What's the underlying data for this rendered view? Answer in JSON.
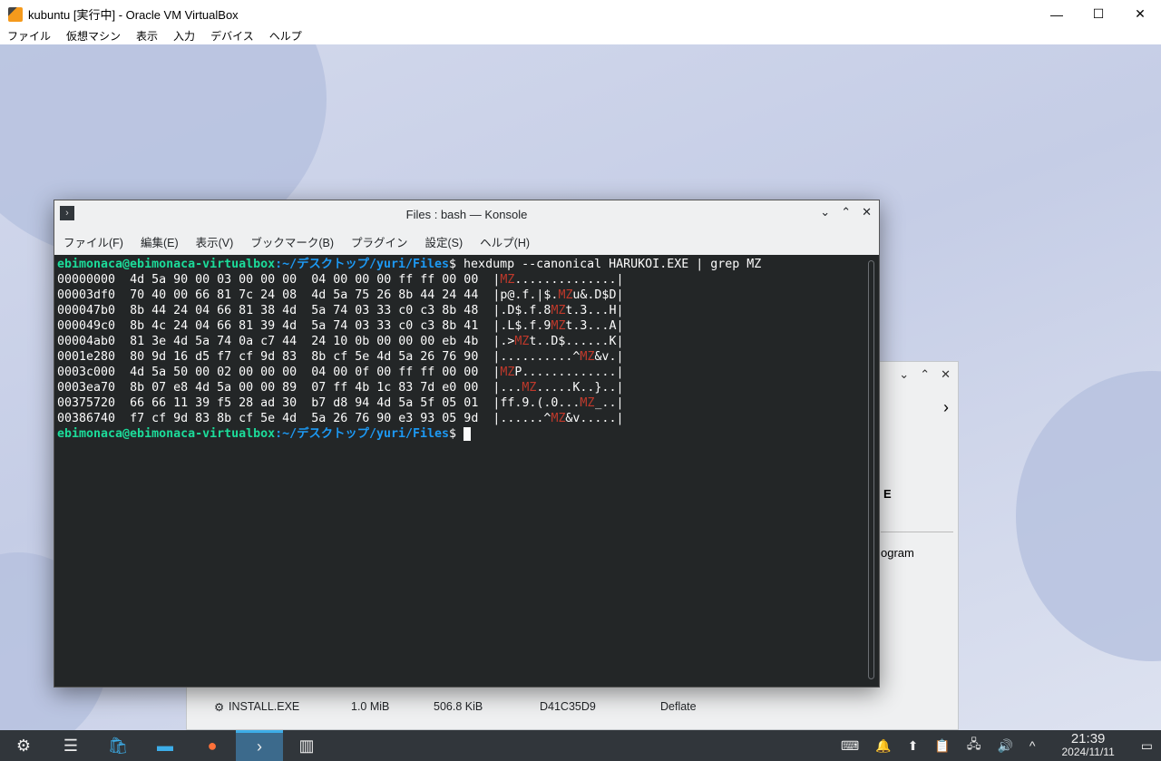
{
  "vbox": {
    "title": "kubuntu [実行中] - Oracle VM VirtualBox",
    "menu": [
      "ファイル",
      "仮想マシン",
      "表示",
      "入力",
      "デバイス",
      "ヘルプ"
    ]
  },
  "bg_window": {
    "partial_text_1": "E",
    "partial_text_2": "ogram",
    "row": {
      "name": "INSTALL.EXE",
      "size": "1.0 MiB",
      "compressed": "506.8 KiB",
      "crc": "D41C35D9",
      "method": "Deflate"
    }
  },
  "konsole": {
    "title": "Files : bash — Konsole",
    "menu": [
      "ファイル(F)",
      "編集(E)",
      "表示(V)",
      "ブックマーク(B)",
      "プラグイン",
      "設定(S)",
      "ヘルプ(H)"
    ],
    "prompt_user": "ebimonaca@ebimonaca-virtualbox",
    "prompt_path": ":~/デスクトップ/yuri/Files",
    "prompt_dollar": "$ ",
    "command": "hexdump --canonical HARUKOI.EXE | grep MZ",
    "lines": [
      {
        "off": "00000000",
        "hex": "4d 5a 90 00 03 00 00 00  04 00 00 00 ff ff 00 00",
        "ascii": "MZ.............."
      },
      {
        "off": "00003df0",
        "hex": "70 40 00 66 81 7c 24 08  4d 5a 75 26 8b 44 24 44",
        "ascii": "p@.f.|$.MZu&.D$D"
      },
      {
        "off": "000047b0",
        "hex": "8b 44 24 04 66 81 38 4d  5a 74 03 33 c0 c3 8b 48",
        "ascii": ".D$.f.8MZt.3...H"
      },
      {
        "off": "000049c0",
        "hex": "8b 4c 24 04 66 81 39 4d  5a 74 03 33 c0 c3 8b 41",
        "ascii": ".L$.f.9MZt.3...A"
      },
      {
        "off": "00004ab0",
        "hex": "81 3e 4d 5a 74 0a c7 44  24 10 0b 00 00 00 eb 4b",
        "ascii": ".>MZt..D$......K"
      },
      {
        "off": "0001e280",
        "hex": "80 9d 16 d5 f7 cf 9d 83  8b cf 5e 4d 5a 26 76 90",
        "ascii": "..........^MZ&v."
      },
      {
        "off": "0003c000",
        "hex": "4d 5a 50 00 02 00 00 00  04 00 0f 00 ff ff 00 00",
        "ascii": "MZP............."
      },
      {
        "off": "0003ea70",
        "hex": "8b 07 e8 4d 5a 00 00 89  07 ff 4b 1c 83 7d e0 00",
        "ascii": "...MZ.....K..}.."
      },
      {
        "off": "00375720",
        "hex": "66 66 11 39 f5 28 ad 30  b7 d8 94 4d 5a 5f 05 01",
        "ascii": "ff.9.(.0...MZ_.."
      },
      {
        "off": "00386740",
        "hex": "f7 cf 9d 83 8b cf 5e 4d  5a 26 76 90 e3 93 05 9d",
        "ascii": "......^MZ&v....."
      }
    ]
  },
  "taskbar": {
    "clock_time": "21:39",
    "clock_date": "2024/11/11"
  }
}
